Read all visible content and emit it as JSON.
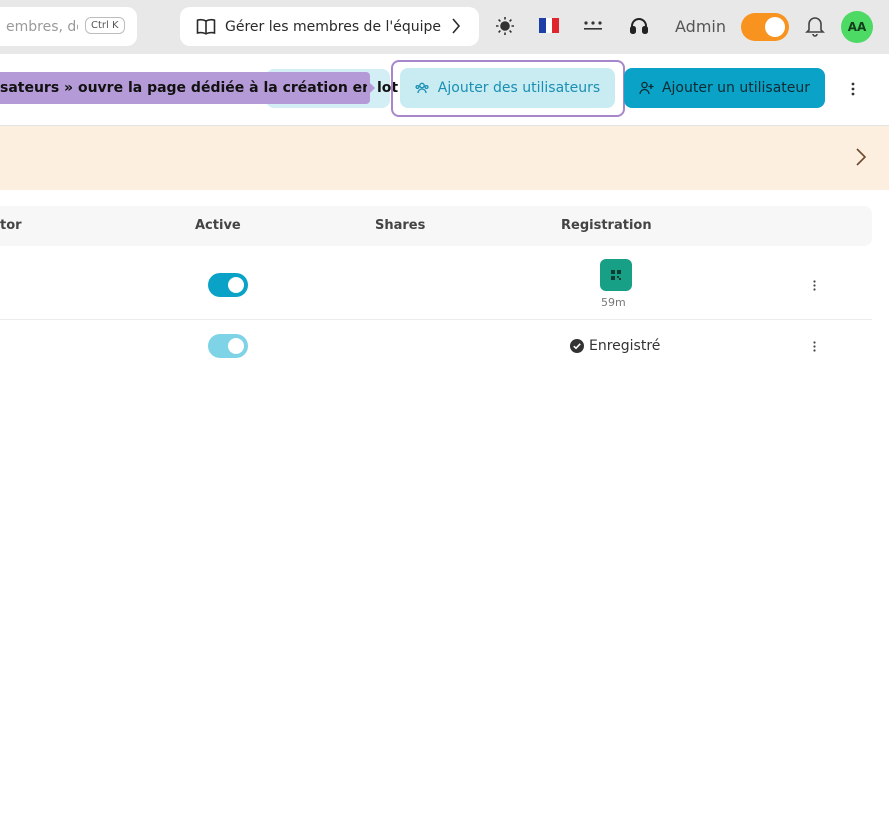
{
  "topbar": {
    "search_placeholder": "embres, doss",
    "search_shortcut": "Ctrl K",
    "guide_label": "Gérer les membres de l'équipe",
    "role_label": "Admin",
    "avatar_initials": "AA",
    "icons": [
      "book-icon",
      "chevron-right-icon",
      "sun-icon",
      "french-flag-icon",
      "dots-icon",
      "support-icon",
      "bell-icon"
    ]
  },
  "toolbar": {
    "tooltip_text": "sateurs » ouvre la page dédiée à la création en lot",
    "add_multiple_label": "Ajouter des utilisateurs",
    "add_single_label": "Ajouter un utilisateur"
  },
  "table": {
    "columns": [
      "tor",
      "Active",
      "Shares",
      "Registration"
    ],
    "rows": [
      {
        "active": true,
        "registration_type": "qr",
        "registration_time": "59m"
      },
      {
        "active": true,
        "registration_type": "status",
        "registration_status": "Enregistré"
      }
    ]
  },
  "colors": {
    "accent": "#0ba2c8",
    "toggle_orange": "#f7931e",
    "avatar_green": "#4cd964",
    "tooltip_purple": "#b49ad6",
    "banner_bg": "#fdefdf",
    "qr_green": "#17a086"
  }
}
